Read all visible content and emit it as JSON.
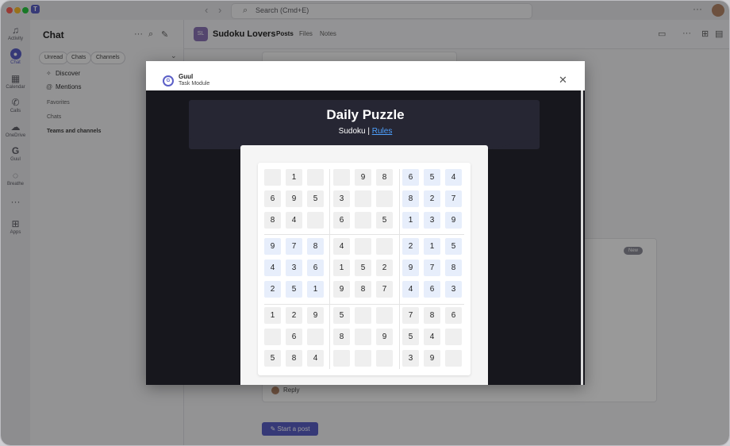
{
  "app": {
    "search_placeholder": "Search (Cmd+E)"
  },
  "rail": [
    {
      "label": "Activity",
      "icon": "bell-icon"
    },
    {
      "label": "Chat",
      "icon": "chat-icon"
    },
    {
      "label": "Calendar",
      "icon": "calendar-icon"
    },
    {
      "label": "Calls",
      "icon": "phone-icon"
    },
    {
      "label": "OneDrive",
      "icon": "cloud-icon"
    },
    {
      "label": "Guul",
      "icon": "guul-icon"
    },
    {
      "label": "Breathe",
      "icon": "breathe-icon"
    },
    {
      "label": "Apps",
      "icon": "apps-icon"
    }
  ],
  "sidebar": {
    "title": "Chat",
    "filters": [
      "Unread",
      "Chats",
      "Channels"
    ],
    "links": [
      "Discover",
      "Mentions"
    ],
    "sections": [
      "Favorites",
      "Chats",
      "Teams and channels"
    ]
  },
  "channel": {
    "avatar_text": "SL",
    "name": "Sudoku Lovers",
    "tabs": [
      "Posts",
      "Files",
      "Notes"
    ],
    "active_tab": "Posts",
    "new_badge": "New",
    "reply_label": "Reply",
    "start_post_label": "Start a post"
  },
  "modal": {
    "app_name": "Guul",
    "subtitle": "Task Module",
    "puzzle_title": "Daily Puzzle",
    "game_name": "Sudoku",
    "separator": "|",
    "rules_link": "Rules"
  },
  "sudoku": {
    "grid": [
      [
        "",
        "1",
        "",
        "",
        "9",
        "8",
        "6",
        "5",
        "4"
      ],
      [
        "6",
        "9",
        "5",
        "3",
        "",
        "",
        "8",
        "2",
        "7"
      ],
      [
        "8",
        "4",
        "",
        "6",
        "",
        "5",
        "1",
        "3",
        "9"
      ],
      [
        "9",
        "7",
        "8",
        "4",
        "",
        "",
        "2",
        "1",
        "5"
      ],
      [
        "4",
        "3",
        "6",
        "1",
        "5",
        "2",
        "9",
        "7",
        "8"
      ],
      [
        "2",
        "5",
        "1",
        "9",
        "8",
        "7",
        "4",
        "6",
        "3"
      ],
      [
        "1",
        "2",
        "9",
        "5",
        "",
        "",
        "7",
        "8",
        "6"
      ],
      [
        "",
        "6",
        "",
        "8",
        "",
        "9",
        "5",
        "4",
        ""
      ],
      [
        "5",
        "8",
        "4",
        "",
        "",
        "",
        "3",
        "9",
        ""
      ]
    ],
    "blue_cells": [
      [
        0,
        6
      ],
      [
        0,
        7
      ],
      [
        0,
        8
      ],
      [
        1,
        6
      ],
      [
        1,
        7
      ],
      [
        1,
        8
      ],
      [
        2,
        6
      ],
      [
        2,
        7
      ],
      [
        2,
        8
      ],
      [
        3,
        0
      ],
      [
        3,
        1
      ],
      [
        3,
        2
      ],
      [
        4,
        0
      ],
      [
        4,
        1
      ],
      [
        4,
        2
      ],
      [
        5,
        0
      ],
      [
        5,
        1
      ],
      [
        5,
        2
      ],
      [
        3,
        6
      ],
      [
        3,
        7
      ],
      [
        3,
        8
      ],
      [
        4,
        6
      ],
      [
        4,
        7
      ],
      [
        4,
        8
      ],
      [
        5,
        6
      ],
      [
        5,
        7
      ],
      [
        5,
        8
      ]
    ]
  },
  "colors": {
    "accent": "#5b5fc7",
    "modal_body": "#17171d",
    "link": "#4ea1ff",
    "cell_blue": "#e7eefb",
    "cell_gray": "#efefef"
  }
}
